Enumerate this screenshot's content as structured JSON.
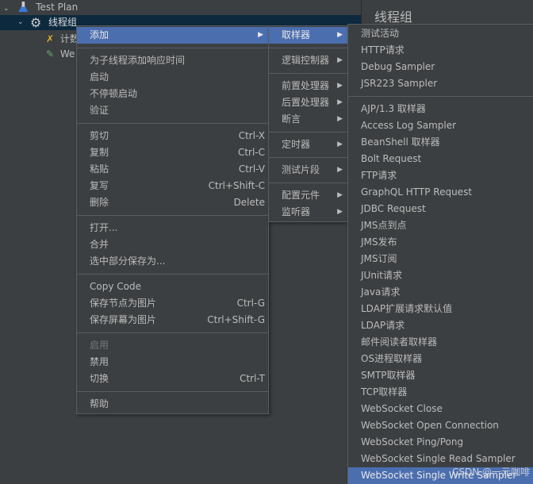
{
  "tree": {
    "items": [
      {
        "label": "Test Plan",
        "icon": "flask-icon"
      },
      {
        "label": "线程组",
        "icon": "gear-icon"
      },
      {
        "label": "计数",
        "icon": "tools-icon"
      },
      {
        "label": "We",
        "icon": "dropper-icon"
      }
    ]
  },
  "right_panel": {
    "title": "线程组"
  },
  "context_menu": {
    "groups": [
      [
        {
          "label": "添加",
          "submenu": true,
          "highlight": true
        }
      ],
      [
        {
          "label": "为子线程添加响应时间"
        },
        {
          "label": "启动"
        },
        {
          "label": "不停顿启动"
        },
        {
          "label": "验证"
        }
      ],
      [
        {
          "label": "剪切",
          "shortcut": "Ctrl-X"
        },
        {
          "label": "复制",
          "shortcut": "Ctrl-C"
        },
        {
          "label": "粘贴",
          "shortcut": "Ctrl-V"
        },
        {
          "label": "复写",
          "shortcut": "Ctrl+Shift-C"
        },
        {
          "label": "删除",
          "shortcut": "Delete"
        }
      ],
      [
        {
          "label": "打开..."
        },
        {
          "label": "合并"
        },
        {
          "label": "选中部分保存为..."
        }
      ],
      [
        {
          "label": "Copy Code"
        },
        {
          "label": "保存节点为图片",
          "shortcut": "Ctrl-G"
        },
        {
          "label": "保存屏幕为图片",
          "shortcut": "Ctrl+Shift-G"
        }
      ],
      [
        {
          "label": "启用",
          "disabled": true
        },
        {
          "label": "禁用"
        },
        {
          "label": "切换",
          "shortcut": "Ctrl-T"
        }
      ],
      [
        {
          "label": "帮助"
        }
      ]
    ]
  },
  "add_menu": {
    "groups": [
      [
        {
          "label": "取样器",
          "submenu": true,
          "highlight": true
        }
      ],
      [
        {
          "label": "逻辑控制器",
          "submenu": true
        }
      ],
      [
        {
          "label": "前置处理器",
          "submenu": true
        },
        {
          "label": "后置处理器",
          "submenu": true
        },
        {
          "label": "断言",
          "submenu": true
        }
      ],
      [
        {
          "label": "定时器",
          "submenu": true
        }
      ],
      [
        {
          "label": "测试片段",
          "submenu": true
        }
      ],
      [
        {
          "label": "配置元件",
          "submenu": true
        },
        {
          "label": "监听器",
          "submenu": true
        }
      ]
    ]
  },
  "sampler_menu": {
    "groups": [
      [
        {
          "label": "测试活动"
        },
        {
          "label": "HTTP请求"
        },
        {
          "label": "Debug Sampler"
        },
        {
          "label": "JSR223 Sampler"
        }
      ],
      [
        {
          "label": "AJP/1.3 取样器"
        },
        {
          "label": "Access Log Sampler"
        },
        {
          "label": "BeanShell 取样器"
        },
        {
          "label": "Bolt Request"
        },
        {
          "label": "FTP请求"
        },
        {
          "label": "GraphQL HTTP Request"
        },
        {
          "label": "JDBC Request"
        },
        {
          "label": "JMS点到点"
        },
        {
          "label": "JMS发布"
        },
        {
          "label": "JMS订阅"
        },
        {
          "label": "JUnit请求"
        },
        {
          "label": "Java请求"
        },
        {
          "label": "LDAP扩展请求默认值"
        },
        {
          "label": "LDAP请求"
        },
        {
          "label": "邮件阅读者取样器"
        },
        {
          "label": "OS进程取样器"
        },
        {
          "label": "SMTP取样器"
        },
        {
          "label": "TCP取样器"
        },
        {
          "label": "WebSocket Close"
        },
        {
          "label": "WebSocket Open Connection"
        },
        {
          "label": "WebSocket Ping/Pong"
        },
        {
          "label": "WebSocket Single Read Sampler"
        },
        {
          "label": "WebSocket Single Write Sampler",
          "highlight": true
        }
      ]
    ]
  },
  "watermark": "CSDN @一元咖啡",
  "colors": {
    "highlight": "#4b6eaf",
    "background": "#3c3f41",
    "selected_row": "#0d293e"
  }
}
